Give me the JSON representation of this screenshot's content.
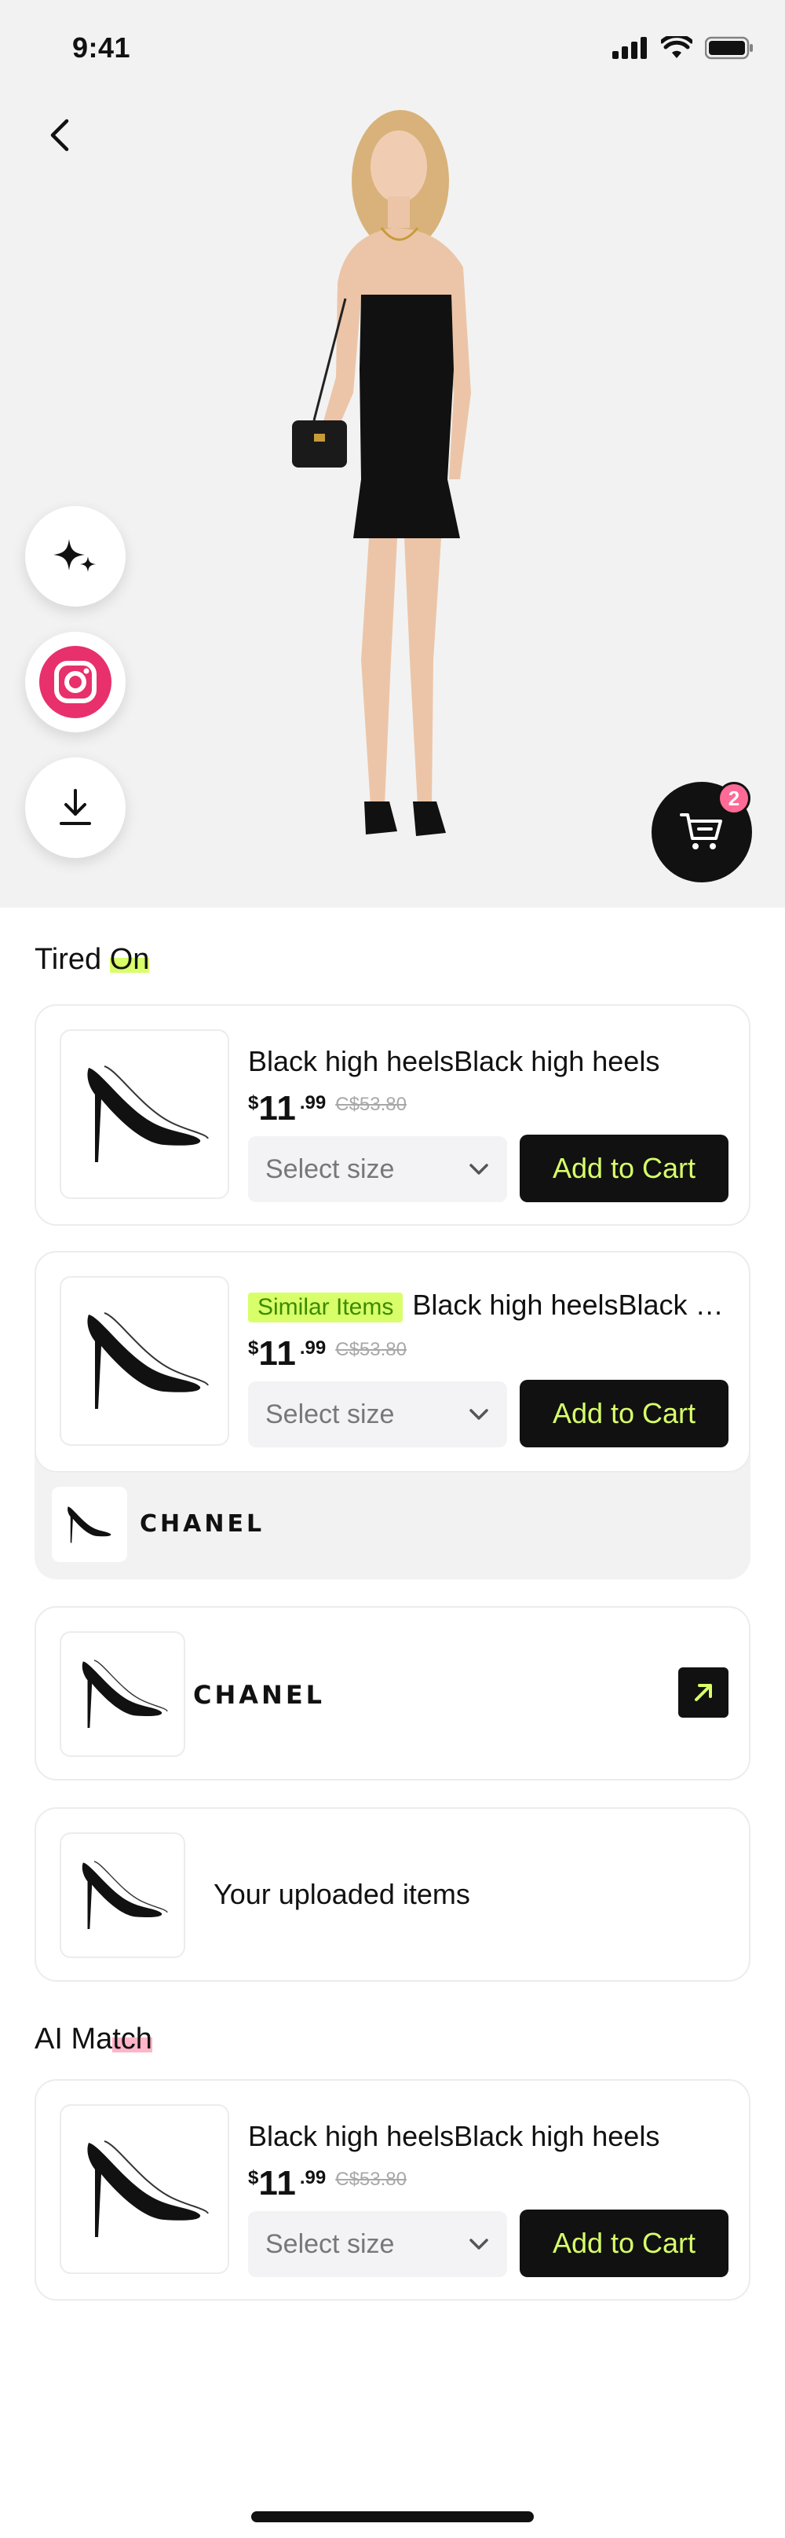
{
  "status": {
    "time": "9:41"
  },
  "cart": {
    "count": "2"
  },
  "tried_on": {
    "title_a": "Tired ",
    "title_b": "On"
  },
  "ai_match": {
    "title_a": "AI Ma",
    "title_b": "tch"
  },
  "products": [
    {
      "title": "Black high heelsBlack high heels",
      "currency": "$",
      "price_main": "11",
      "price_cents": ".99",
      "old_price": "C$53.80",
      "size_placeholder": "Select size",
      "add_label": "Add to Cart"
    },
    {
      "tag": "Similar Items",
      "title": "Black high heelsBlack high heels",
      "currency": "$",
      "price_main": "11",
      "price_cents": ".99",
      "old_price": "C$53.80",
      "size_placeholder": "Select size",
      "add_label": "Add to Cart"
    },
    {
      "title": "Black high heelsBlack high heels",
      "currency": "$",
      "price_main": "11",
      "price_cents": ".99",
      "old_price": "C$53.80",
      "size_placeholder": "Select size",
      "add_label": "Add to Cart"
    }
  ],
  "brand": {
    "name": "CHANEL"
  },
  "uploaded": {
    "label": "Your uploaded items"
  },
  "colors": {
    "accent": "#d8ff6a",
    "badge": "#ff6a96",
    "dark": "#111111"
  },
  "icons": [
    "back-arrow-icon",
    "sparkle-icon",
    "instagram-icon",
    "download-icon",
    "cart-icon",
    "chevron-down-icon",
    "arrow-up-right-icon",
    "high-heels-icon"
  ]
}
